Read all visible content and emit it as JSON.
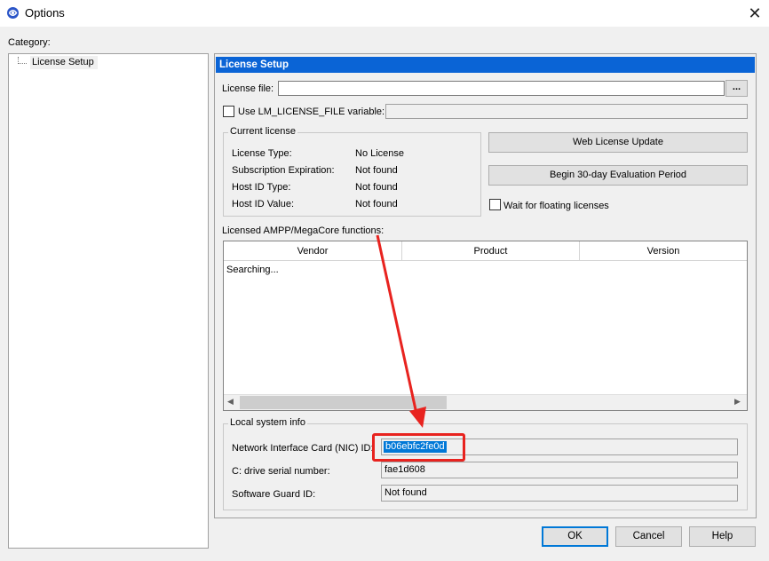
{
  "window": {
    "title": "Options",
    "close_glyph": "✕"
  },
  "category_label": "Category:",
  "tree": {
    "items": [
      {
        "label": "License Setup"
      }
    ]
  },
  "panel": {
    "header": "License Setup",
    "license_file": {
      "label": "License file:",
      "value": "",
      "browse_label": "..."
    },
    "lm_license": {
      "label": "Use LM_LICENSE_FILE variable:",
      "checked": false,
      "value": ""
    },
    "current_license": {
      "title": "Current license",
      "rows": [
        {
          "label": "License Type:",
          "value": "No License"
        },
        {
          "label": "Subscription Expiration:",
          "value": "Not found"
        },
        {
          "label": "Host ID Type:",
          "value": "Not found"
        },
        {
          "label": "Host ID Value:",
          "value": "Not found"
        }
      ]
    },
    "web_license_update_label": "Web License Update",
    "eval_period_label": "Begin 30-day Evaluation Period",
    "wait_floating": {
      "label": "Wait for floating licenses",
      "checked": false
    },
    "licensed_functions": {
      "label": "Licensed AMPP/MegaCore functions:",
      "columns": [
        "Vendor",
        "Product",
        "Version"
      ],
      "status": "Searching..."
    },
    "local_system": {
      "title": "Local system info",
      "nic": {
        "label": "Network Interface Card (NIC) ID:",
        "value": "b06ebfc2fe0d"
      },
      "drive": {
        "label": "C: drive serial number:",
        "value": "fae1d608"
      },
      "guard": {
        "label": "Software Guard ID:",
        "value": "Not found"
      }
    }
  },
  "buttons": {
    "ok": "OK",
    "cancel": "Cancel",
    "help": "Help"
  },
  "annotation": {
    "color": "#e8231f"
  },
  "colors": {
    "header_bg": "#0a64d6",
    "selection_bg": "#0078d7"
  }
}
